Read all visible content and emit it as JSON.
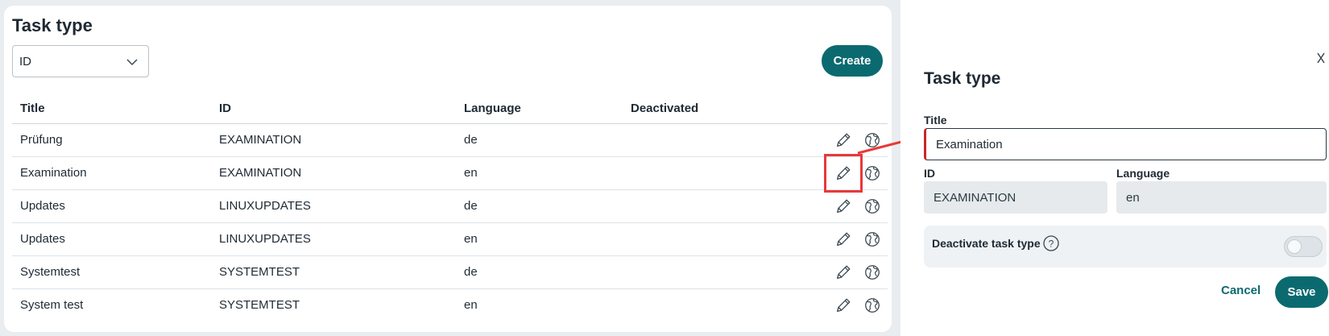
{
  "list": {
    "title": "Task type",
    "filter_select": {
      "value": "ID"
    },
    "create_label": "Create",
    "columns": [
      "Title",
      "ID",
      "Language",
      "Deactivated"
    ],
    "rows": [
      {
        "title": "Prüfung",
        "id": "EXAMINATION",
        "language": "de",
        "deactivated": ""
      },
      {
        "title": "Examination",
        "id": "EXAMINATION",
        "language": "en",
        "deactivated": ""
      },
      {
        "title": "Updates",
        "id": "LINUXUPDATES",
        "language": "de",
        "deactivated": ""
      },
      {
        "title": "Updates",
        "id": "LINUXUPDATES",
        "language": "en",
        "deactivated": ""
      },
      {
        "title": "Systemtest",
        "id": "SYSTEMTEST",
        "language": "de",
        "deactivated": ""
      },
      {
        "title": "System test",
        "id": "SYSTEMTEST",
        "language": "en",
        "deactivated": ""
      }
    ],
    "row_action_icons": [
      "pencil-icon",
      "globe-icon"
    ],
    "highlighted_row": 1
  },
  "panel": {
    "title": "Task type",
    "title_label": "Title",
    "title_value": "Examination",
    "id_label": "ID",
    "id_value": "EXAMINATION",
    "language_label": "Language",
    "language_value": "en",
    "deactivate_label": "Deactivate task type",
    "deactivated": false,
    "cancel_label": "Cancel",
    "save_label": "Save"
  },
  "colors": {
    "primary": "#0b6a70",
    "highlight": "#e8393a",
    "error_accent": "#c62828",
    "page_bg": "#e9edf0"
  }
}
